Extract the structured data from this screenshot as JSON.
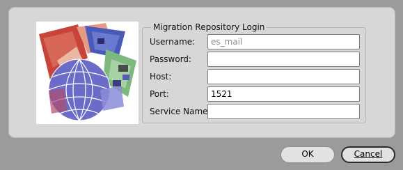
{
  "dialog": {
    "group_title": "Migration Repository Login",
    "fields": [
      {
        "label": "Username:",
        "value": "es_mail",
        "placeholder": ""
      },
      {
        "label": "Password:",
        "value": "",
        "placeholder": ""
      },
      {
        "label": "Host:",
        "value": "",
        "placeholder": ""
      },
      {
        "label": "Port:",
        "value": "1521",
        "placeholder": ""
      },
      {
        "label": "Service Name:",
        "value": "",
        "placeholder": ""
      }
    ]
  },
  "buttons": {
    "ok_label": "OK",
    "cancel_label": "Cancel"
  },
  "splash": {
    "icon": "migration-globe-illustration"
  },
  "colors": {
    "background": "#9b9b9b",
    "panel": "#d7d7d7",
    "field": "#ffffff",
    "illustration_red": "#c8443a",
    "illustration_blue": "#5a5ab8",
    "illustration_green": "#7db87d"
  }
}
